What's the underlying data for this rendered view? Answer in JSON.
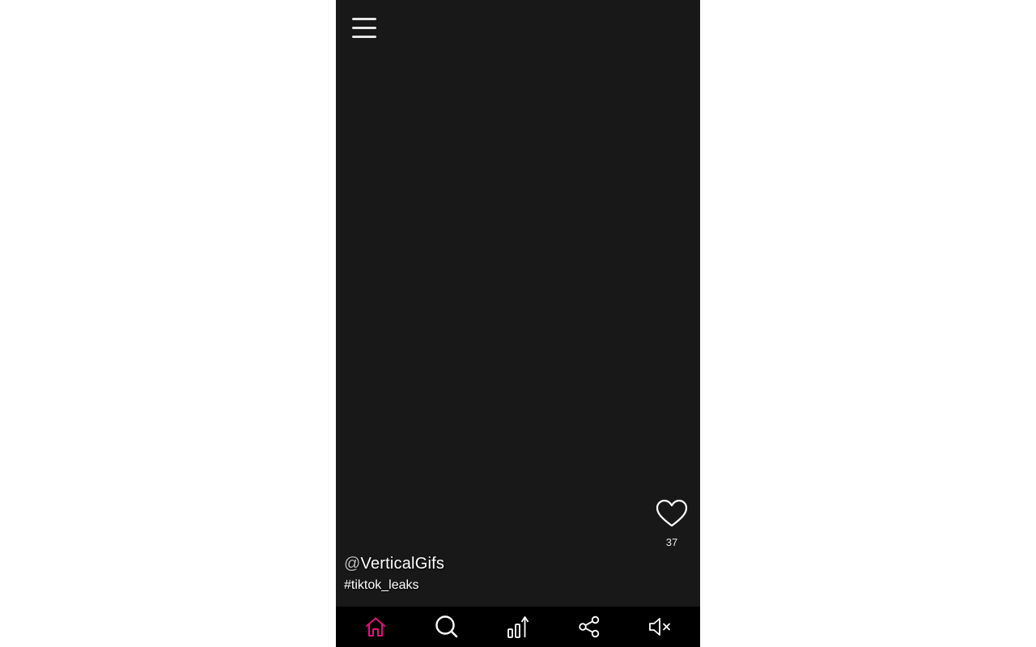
{
  "post": {
    "username_prefix": "@",
    "username": "VerticalGifs",
    "hashtag": "#tiktok_leaks",
    "like_count": "37"
  },
  "colors": {
    "accent": "#e0147a",
    "background": "#181818",
    "nav_background": "#000000",
    "icon": "#ffffff"
  },
  "icons": {
    "menu": "hamburger-menu-icon",
    "like": "heart-icon",
    "nav": [
      "home-icon",
      "search-icon",
      "trending-icon",
      "share-icon",
      "mute-icon"
    ]
  }
}
